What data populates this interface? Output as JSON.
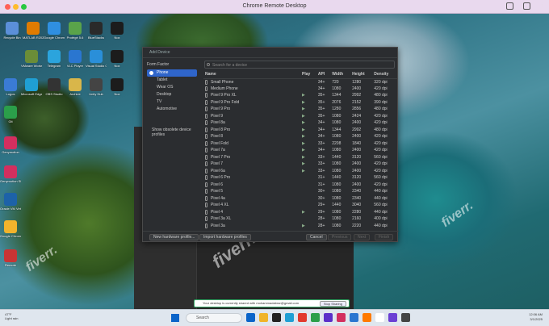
{
  "window": {
    "title": "Chrome Remote Desktop",
    "icons": [
      "share-icon",
      "copy-icon",
      "menu-icon"
    ]
  },
  "desktop_icons": [
    {
      "label": "Recycle Bin",
      "color": "#5b8fd9"
    },
    {
      "label": "MATLAB R2024a",
      "color": "#e07b00"
    },
    {
      "label": "Google Chrome",
      "color": "#2f8fe0"
    },
    {
      "label": "Protégé 5.6",
      "color": "#5aa34a"
    },
    {
      "label": "BlueStacks",
      "color": "#2a2a2a"
    },
    {
      "label": "Nox",
      "color": "#1c1c1c"
    },
    {
      "label": "VMware Workstat...",
      "color": "#6b8d38"
    },
    {
      "label": "Telegram",
      "color": "#2ba4dd"
    },
    {
      "label": "VLC Player",
      "color": "#2a76d0"
    },
    {
      "label": "Visual Studio Code",
      "color": "#2a8fd9"
    },
    {
      "label": "Nox",
      "color": "#1c1c1c"
    },
    {
      "label": "Logos",
      "color": "#3a7bd5"
    },
    {
      "label": "Microsoft Edge",
      "color": "#1f9fd4"
    },
    {
      "label": "OBS Studio",
      "color": "#333333"
    },
    {
      "label": "Archive",
      "color": "#d9b64a"
    },
    {
      "label": "Unity Hub",
      "color": "#444444"
    },
    {
      "label": "Nox",
      "color": "#1c1c1c"
    },
    {
      "label": "Git",
      "color": "#2b9f4a"
    },
    {
      "label": "Genymotion",
      "color": "#d32f5f"
    },
    {
      "label": "Genymotion Shell",
      "color": "#d32f5f"
    },
    {
      "label": "Oracle VM VirtualBox",
      "color": "#1d62a8"
    },
    {
      "label": "Google Chrome",
      "color": "#f2b32c"
    },
    {
      "label": "Remote",
      "color": "#c93434"
    }
  ],
  "dialog": {
    "header": "Add Device",
    "form_factor_title": "Form Factor",
    "form_factors": [
      "Phone",
      "Tablet",
      "Wear OS",
      "Desktop",
      "TV",
      "Automotive"
    ],
    "selected_form_factor": "Phone",
    "show_obsolete": "Show obsolete device profiles",
    "search_placeholder": "Search for a device",
    "columns": [
      "Name",
      "Play",
      "API",
      "Width",
      "Height",
      "Density"
    ],
    "devices": [
      {
        "name": "Small Phone",
        "play": "",
        "api": "34+",
        "width": "720",
        "height": "1280",
        "density": "320 dpi"
      },
      {
        "name": "Medium Phone",
        "play": "",
        "api": "34+",
        "width": "1080",
        "height": "2400",
        "density": "420 dpi"
      },
      {
        "name": "Pixel 9 Pro XL",
        "play": "▶",
        "api": "35+",
        "width": "1344",
        "height": "2992",
        "density": "480 dpi"
      },
      {
        "name": "Pixel 9 Pro Fold",
        "play": "▶",
        "api": "35+",
        "width": "2076",
        "height": "2152",
        "density": "390 dpi"
      },
      {
        "name": "Pixel 9 Pro",
        "play": "▶",
        "api": "35+",
        "width": "1280",
        "height": "2856",
        "density": "480 dpi"
      },
      {
        "name": "Pixel 9",
        "play": "▶",
        "api": "35+",
        "width": "1080",
        "height": "2424",
        "density": "420 dpi"
      },
      {
        "name": "Pixel 8a",
        "play": "▶",
        "api": "34+",
        "width": "1080",
        "height": "2400",
        "density": "420 dpi"
      },
      {
        "name": "Pixel 8 Pro",
        "play": "▶",
        "api": "34+",
        "width": "1344",
        "height": "2992",
        "density": "480 dpi"
      },
      {
        "name": "Pixel 8",
        "play": "▶",
        "api": "34+",
        "width": "1080",
        "height": "2400",
        "density": "420 dpi"
      },
      {
        "name": "Pixel Fold",
        "play": "▶",
        "api": "33+",
        "width": "2208",
        "height": "1840",
        "density": "420 dpi"
      },
      {
        "name": "Pixel 7a",
        "play": "▶",
        "api": "34+",
        "width": "1080",
        "height": "2400",
        "density": "420 dpi"
      },
      {
        "name": "Pixel 7 Pro",
        "play": "▶",
        "api": "33+",
        "width": "1440",
        "height": "3120",
        "density": "560 dpi"
      },
      {
        "name": "Pixel 7",
        "play": "▶",
        "api": "33+",
        "width": "1080",
        "height": "2400",
        "density": "420 dpi"
      },
      {
        "name": "Pixel 6a",
        "play": "▶",
        "api": "33+",
        "width": "1080",
        "height": "2400",
        "density": "420 dpi"
      },
      {
        "name": "Pixel 6 Pro",
        "play": "",
        "api": "31+",
        "width": "1440",
        "height": "3120",
        "density": "560 dpi"
      },
      {
        "name": "Pixel 6",
        "play": "",
        "api": "31+",
        "width": "1080",
        "height": "2400",
        "density": "420 dpi"
      },
      {
        "name": "Pixel 5",
        "play": "",
        "api": "30+",
        "width": "1080",
        "height": "2340",
        "density": "440 dpi"
      },
      {
        "name": "Pixel 4a",
        "play": "",
        "api": "30+",
        "width": "1080",
        "height": "2340",
        "density": "440 dpi"
      },
      {
        "name": "Pixel 4 XL",
        "play": "",
        "api": "29+",
        "width": "1440",
        "height": "3040",
        "density": "560 dpi"
      },
      {
        "name": "Pixel 4",
        "play": "▶",
        "api": "29+",
        "width": "1080",
        "height": "2280",
        "density": "440 dpi"
      },
      {
        "name": "Pixel 3a XL",
        "play": "",
        "api": "28+",
        "width": "1080",
        "height": "2160",
        "density": "400 dpi"
      },
      {
        "name": "Pixel 3a",
        "play": "▶",
        "api": "28+",
        "width": "1080",
        "height": "2220",
        "density": "440 dpi"
      }
    ],
    "buttons": {
      "new_profile": "New hardware profile...",
      "import_profiles": "Import hardware profiles",
      "cancel": "Cancel",
      "previous": "Previous",
      "next": "Next",
      "finish": "Finish"
    }
  },
  "share_bar": {
    "text": "Your desktop is currently shared with mohammadabrar@gmail.com",
    "stop": "Stop Sharing"
  },
  "taskbar": {
    "temperature": "47°F",
    "weather": "Light rain",
    "search": "Search",
    "time": "12:06 AM",
    "date": "3/1/2025",
    "apps": [
      "#0a64c9",
      "#f0b429",
      "#222222",
      "#1f9fd4",
      "#e23a2e",
      "#2b9f4a",
      "#5b2fc9",
      "#d32f5f",
      "#2a76d0",
      "#ff7a00",
      "#ffffff",
      "#6b3fd4",
      "#444444"
    ]
  },
  "watermark": "fiverr."
}
